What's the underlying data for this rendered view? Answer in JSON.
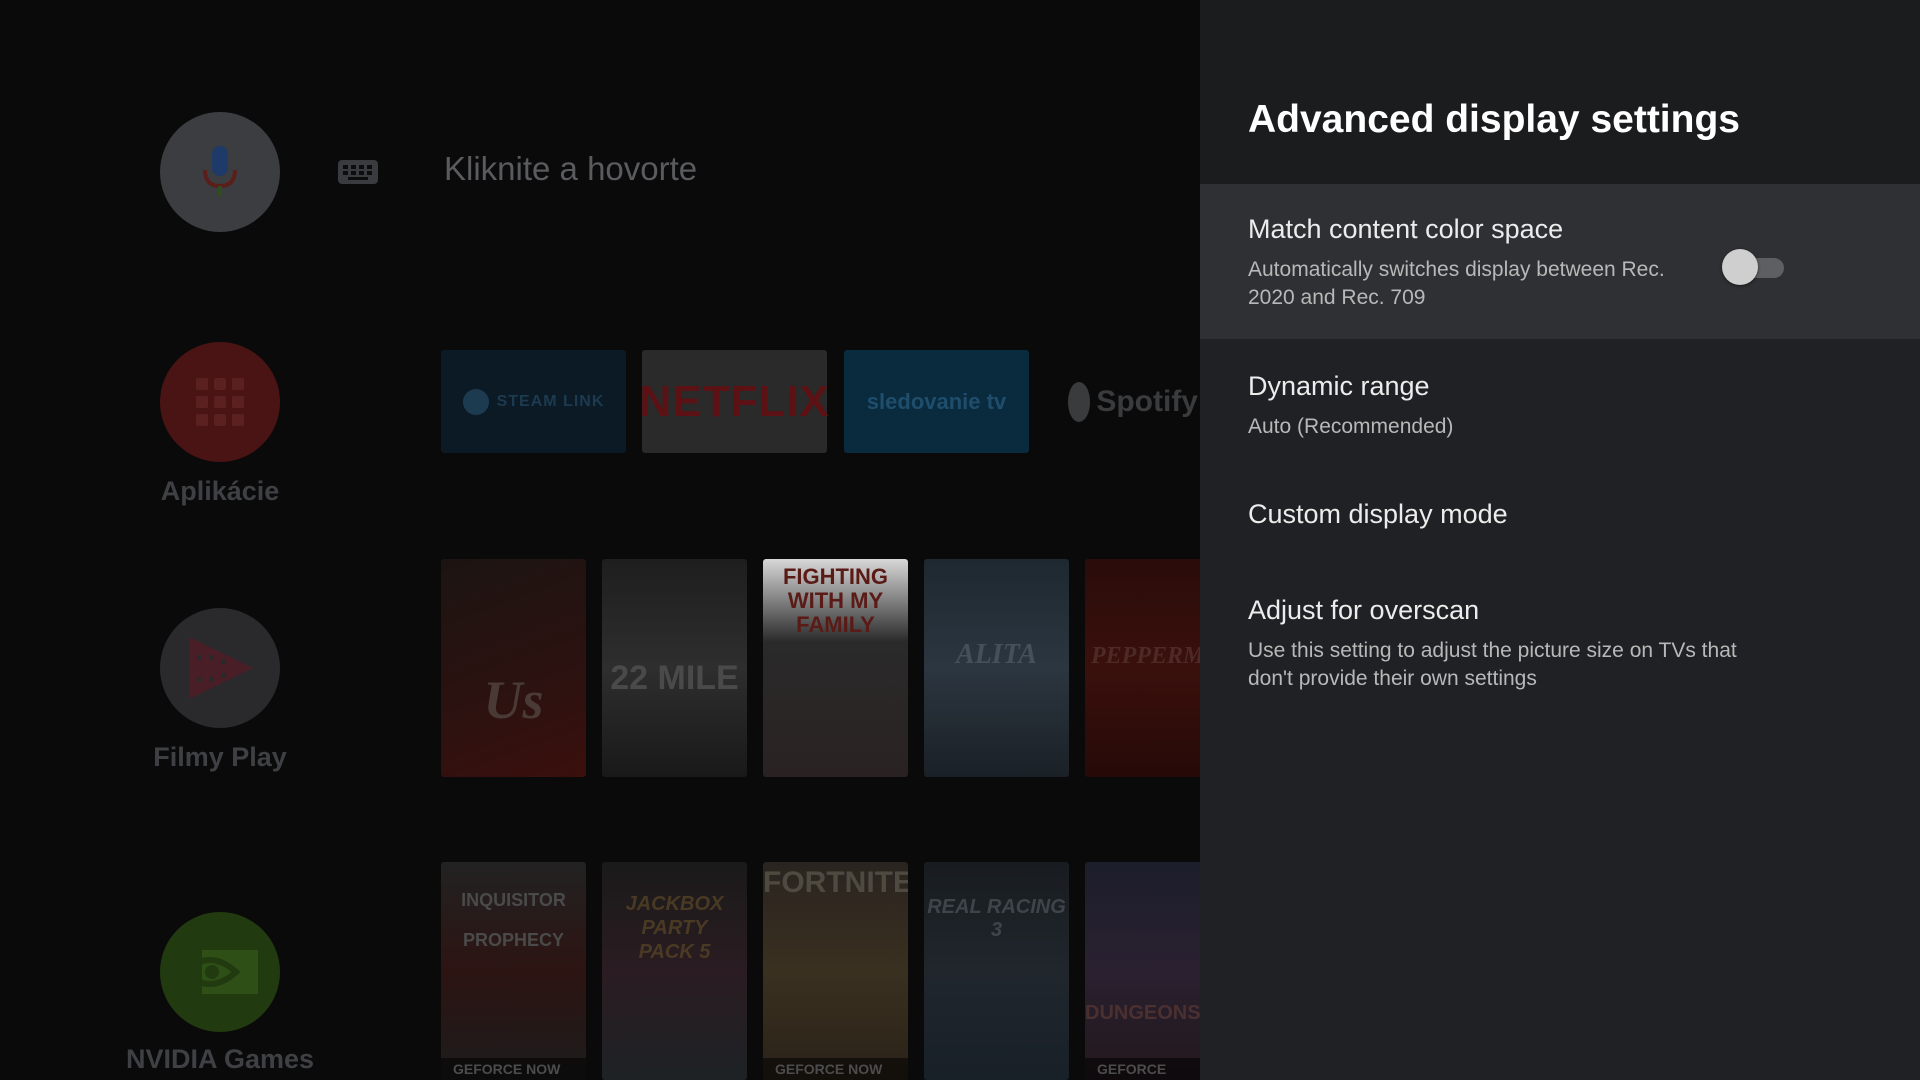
{
  "launcher": {
    "search_hint": "Kliknite a hovorte",
    "side_items": [
      {
        "label": "Aplikácie"
      },
      {
        "label": "Filmy Play"
      },
      {
        "label": "NVIDIA Games"
      }
    ],
    "apps_row": [
      {
        "label": "STEAM LINK"
      },
      {
        "label": "NETFLIX"
      },
      {
        "label": "sledovanie tv"
      },
      {
        "label": "Spotify"
      }
    ],
    "movies_row": [
      {
        "title": "Us"
      },
      {
        "title": "22 MILE"
      },
      {
        "title": "FIGHTING WITH MY FAMILY"
      },
      {
        "title": "ALITA"
      },
      {
        "title": "PEPPERMINT"
      }
    ],
    "games_row": [
      {
        "title": "INQUISITOR PROPHECY",
        "badge": "GEFORCE NOW"
      },
      {
        "title": "JACKBOX PARTY PACK 5",
        "badge": ""
      },
      {
        "title": "FORTNITE",
        "badge": "GEFORCE NOW"
      },
      {
        "title": "REAL RACING 3",
        "badge": ""
      },
      {
        "title": "DUNGEONS",
        "badge": "GEFORCE NOW"
      }
    ]
  },
  "panel": {
    "title": "Advanced display settings",
    "settings": [
      {
        "title": "Match content color space",
        "subtitle_line1": "Automatically switches display between Rec.",
        "subtitle_line2": "2020 and Rec. 709",
        "toggle_on": false
      },
      {
        "title": "Dynamic range",
        "subtitle_line1": "Auto (Recommended)"
      },
      {
        "title": "Custom display mode"
      },
      {
        "title": "Adjust for overscan",
        "subtitle_line1": "Use this setting to adjust the picture size on TVs that",
        "subtitle_line2": "don't provide their own settings"
      }
    ]
  },
  "colors": {
    "panel_bg": "#202124",
    "focused_row_bg": "#2f3033",
    "toggle_off_knob": "#cfcfcf"
  }
}
